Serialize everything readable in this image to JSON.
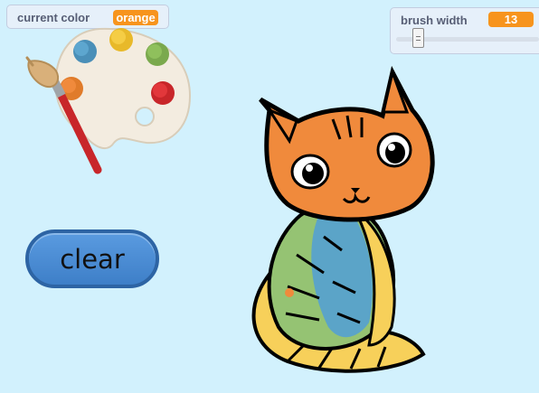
{
  "color_monitor": {
    "label": "current color",
    "value": "orange"
  },
  "brush_monitor": {
    "label": "brush width",
    "value": "13"
  },
  "clear_button": {
    "label": "clear"
  },
  "colors": {
    "background": "#d2f1fd",
    "monitor_badge": "#f7941d",
    "cat_orange": "#f08a3c",
    "cat_green": "#95c373",
    "cat_blue": "#5ba4c8",
    "cat_yellow": "#f7d05a"
  },
  "sprites": {
    "palette": "paint-palette-icon",
    "cat": "coloring-cat-drawing"
  }
}
